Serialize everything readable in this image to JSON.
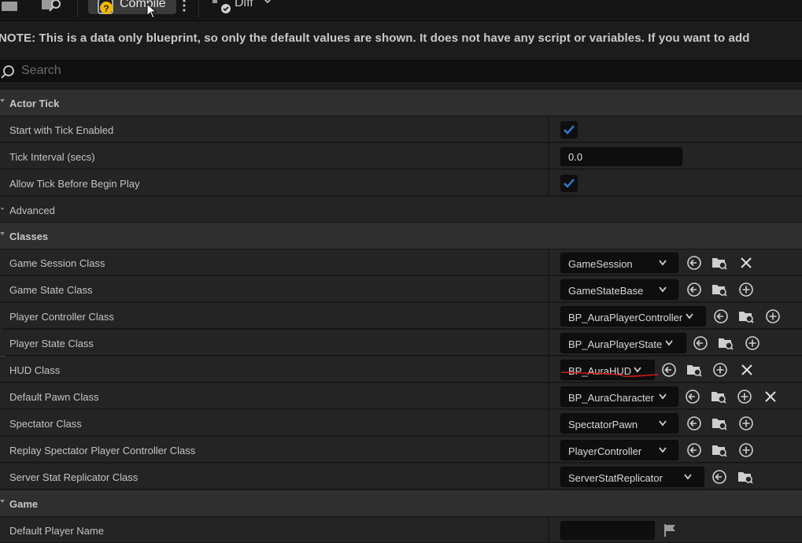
{
  "toolbar": {
    "compile_label": "Compile",
    "diff_label": "Diff"
  },
  "notice": "NOTE: This is a data only blueprint, so only the default values are shown.  It does not have any script or variables.  If you want to add",
  "search": {
    "placeholder": "Search"
  },
  "categories": {
    "actor_tick": "Actor Tick",
    "advanced": "Advanced",
    "classes": "Classes",
    "game": "Game"
  },
  "actor_tick": {
    "start_with_tick_enabled": {
      "label": "Start with Tick Enabled",
      "checked": true
    },
    "tick_interval": {
      "label": "Tick Interval (secs)",
      "value": "0.0"
    },
    "allow_tick_before_begin_play": {
      "label": "Allow Tick Before Begin Play",
      "checked": true
    }
  },
  "classes": {
    "game_session": {
      "label": "Game Session Class",
      "value": "GameSession"
    },
    "game_state": {
      "label": "Game State Class",
      "value": "GameStateBase"
    },
    "player_controller": {
      "label": "Player Controller Class",
      "value": "BP_AuraPlayerController"
    },
    "player_state": {
      "label": "Player State Class",
      "value": "BP_AuraPlayerState"
    },
    "hud": {
      "label": "HUD Class",
      "value": "BP_AuraHUD"
    },
    "default_pawn": {
      "label": "Default Pawn Class",
      "value": "BP_AuraCharacter"
    },
    "spectator": {
      "label": "Spectator Class",
      "value": "SpectatorPawn"
    },
    "replay_spectator_pc": {
      "label": "Replay Spectator Player Controller Class",
      "value": "PlayerController"
    },
    "server_stat_replicator": {
      "label": "Server Stat Replicator Class",
      "value": "ServerStatReplicator"
    }
  },
  "game": {
    "default_player_name": {
      "label": "Default Player Name",
      "value": ""
    }
  },
  "colors": {
    "check_accent": "#2f7fd6",
    "squiggle": "#d01818"
  },
  "icons": [
    "save-icon",
    "content-browser-icon",
    "compile-status-icon",
    "more-options-icon",
    "diff-icon",
    "search-icon",
    "use-selected-icon",
    "browse-asset-icon",
    "add-new-icon",
    "clear-icon",
    "flag-icon"
  ]
}
